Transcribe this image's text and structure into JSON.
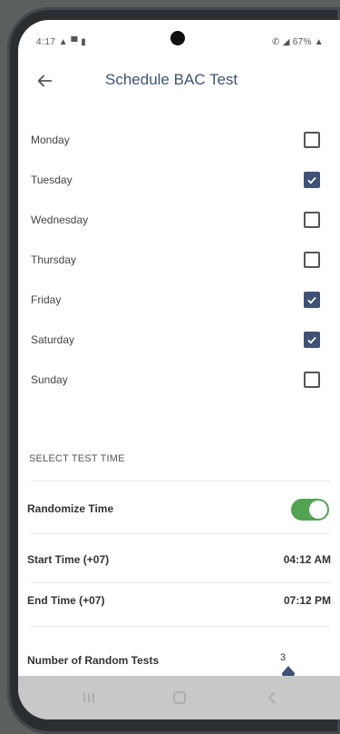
{
  "status_bar": {
    "left": "4:17 ▲ ▀ ▮",
    "right": "✆ ◢ 67% ▲"
  },
  "header": {
    "title": "Schedule BAC Test"
  },
  "days": [
    {
      "label": "Monday",
      "checked": false
    },
    {
      "label": "Tuesday",
      "checked": true
    },
    {
      "label": "Wednesday",
      "checked": false
    },
    {
      "label": "Thursday",
      "checked": false
    },
    {
      "label": "Friday",
      "checked": true
    },
    {
      "label": "Saturday",
      "checked": true
    },
    {
      "label": "Sunday",
      "checked": false
    }
  ],
  "time_section": {
    "header": "SELECT TEST TIME",
    "randomize_label": "Randomize Time",
    "randomize_on": true,
    "start_label": "Start Time (+07)",
    "start_value": "04:12 AM",
    "end_label": "End Time (+07)",
    "end_value": "07:12 PM",
    "random_tests_label": "Number of Random Tests",
    "random_tests_value": "3"
  },
  "colors": {
    "accent": "#3f5176",
    "title": "#3c5478",
    "toggle_on": "#52a452"
  }
}
